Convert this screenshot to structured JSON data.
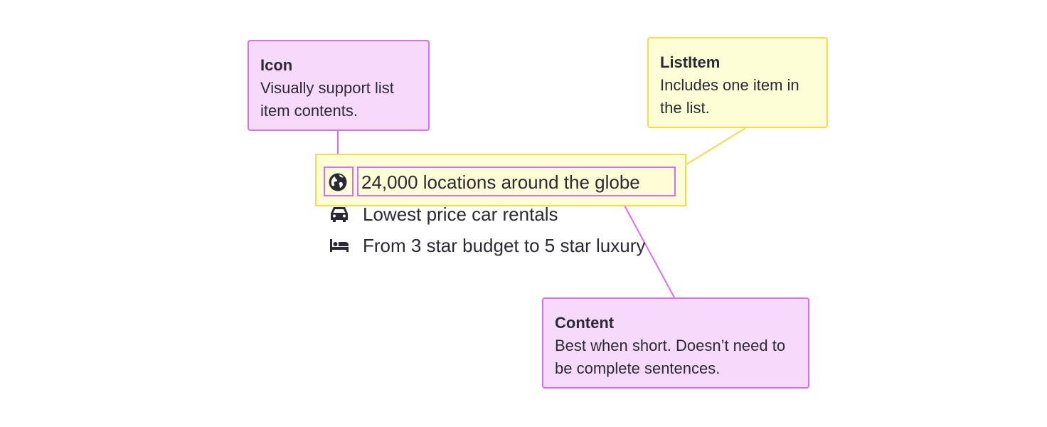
{
  "callouts": {
    "icon": {
      "title": "Icon",
      "description": "Visually support list item contents."
    },
    "list_item": {
      "title": "ListItem",
      "description": "Includes one item in the list."
    },
    "content": {
      "title": "Content",
      "description": "Best when short. Doesn’t need to be complete sentences."
    }
  },
  "list": {
    "items": [
      {
        "icon": "globe-icon",
        "text": "24,000 locations around the globe"
      },
      {
        "icon": "car-icon",
        "text": "Lowest price car rentals"
      },
      {
        "icon": "bed-icon",
        "text": "From 3 star budget to 5 star luxury"
      }
    ]
  },
  "colors": {
    "pink_fill": "#f7d9fc",
    "pink_border": "#d96ef0",
    "yellow_fill": "#fefed6",
    "yellow_border": "#f8d94a",
    "text": "#2a2a36"
  }
}
